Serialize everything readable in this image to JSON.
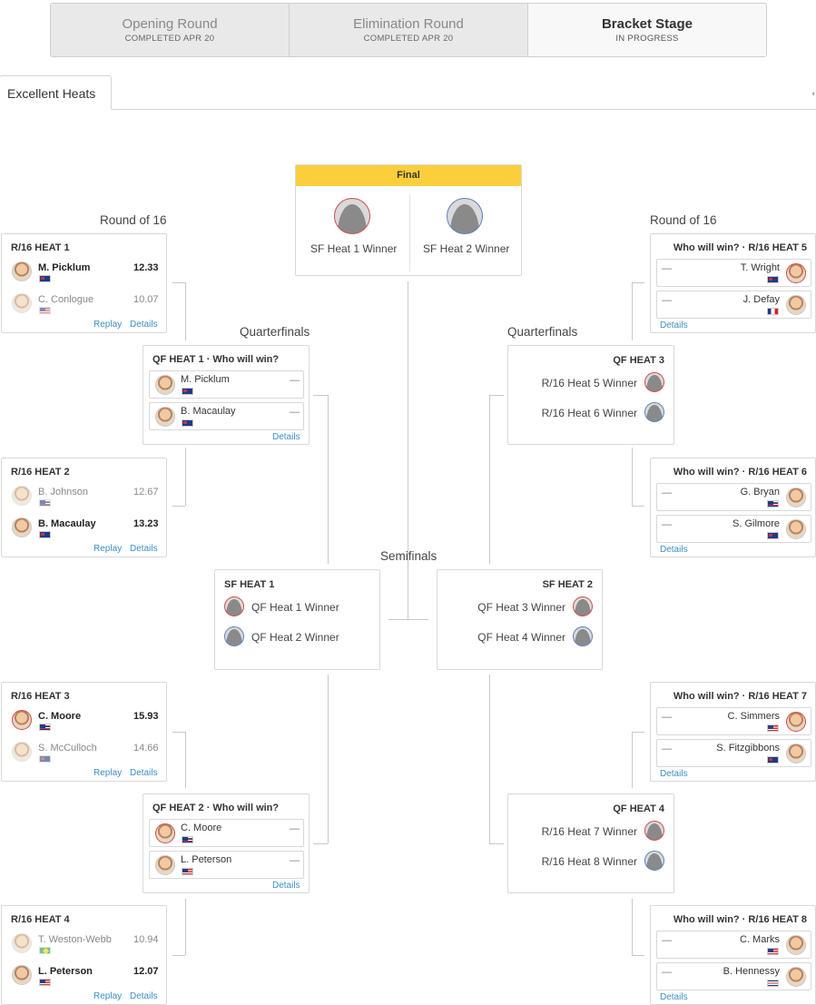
{
  "rounds": [
    {
      "name": "Opening Round",
      "status": "COMPLETED APR 20"
    },
    {
      "name": "Elimination Round",
      "status": "COMPLETED APR 20"
    },
    {
      "name": "Bracket Stage",
      "status": "IN PROGRESS"
    }
  ],
  "heat_tab": "Excellent Heats",
  "labels": {
    "round_of_16": "Round of 16",
    "quarterfinals": "Quarterfinals",
    "semifinals": "Semifinals",
    "final": "Final",
    "replay": "Replay",
    "details": "Details",
    "dash": "—"
  },
  "r16_left": [
    {
      "title": "R/16 HEAT 1",
      "surfers": [
        {
          "name": "M. Picklum",
          "country": "AUS",
          "score": "12.33",
          "winner": true
        },
        {
          "name": "C. Conlogue",
          "country": "USA",
          "score": "10.07",
          "winner": false
        }
      ]
    },
    {
      "title": "R/16 HEAT 2",
      "surfers": [
        {
          "name": "B. Johnson",
          "country": "HAW",
          "score": "12.67",
          "winner": false
        },
        {
          "name": "B. Macaulay",
          "country": "AUS",
          "score": "13.23",
          "winner": true
        }
      ]
    },
    {
      "title": "R/16 HEAT 3",
      "surfers": [
        {
          "name": "C. Moore",
          "country": "HAW",
          "score": "15.93",
          "winner": true
        },
        {
          "name": "S. McCulloch",
          "country": "AUS",
          "score": "14.66",
          "winner": false
        }
      ]
    },
    {
      "title": "R/16 HEAT 4",
      "surfers": [
        {
          "name": "T. Weston-Webb",
          "country": "BRA",
          "score": "10.94",
          "winner": false
        },
        {
          "name": "L. Peterson",
          "country": "USA",
          "score": "12.07",
          "winner": true
        }
      ]
    }
  ],
  "r16_right": [
    {
      "title": "Who will win? · R/16 HEAT 5",
      "surfers": [
        {
          "name": "T. Wright",
          "country": "AUS"
        },
        {
          "name": "J. Defay",
          "country": "FRA"
        }
      ]
    },
    {
      "title": "Who will win? · R/16 HEAT 6",
      "surfers": [
        {
          "name": "G. Bryan",
          "country": "HAW"
        },
        {
          "name": "S. Gilmore",
          "country": "AUS"
        }
      ]
    },
    {
      "title": "Who will win? · R/16 HEAT 7",
      "surfers": [
        {
          "name": "C. Simmers",
          "country": "USA"
        },
        {
          "name": "S. Fitzgibbons",
          "country": "AUS"
        }
      ]
    },
    {
      "title": "Who will win? · R/16 HEAT 8",
      "surfers": [
        {
          "name": "C. Marks",
          "country": "USA"
        },
        {
          "name": "B. Hennessy",
          "country": "CRI"
        }
      ]
    }
  ],
  "qf_left": [
    {
      "title": "QF HEAT 1 · Who will win?",
      "surfers": [
        {
          "name": "M. Picklum",
          "country": "AUS"
        },
        {
          "name": "B. Macaulay",
          "country": "AUS"
        }
      ]
    },
    {
      "title": "QF HEAT 2 · Who will win?",
      "surfers": [
        {
          "name": "C. Moore",
          "country": "HAW"
        },
        {
          "name": "L. Peterson",
          "country": "USA"
        }
      ]
    }
  ],
  "qf_right": [
    {
      "title": "QF HEAT 3",
      "slots": [
        "R/16 Heat 5 Winner",
        "R/16 Heat 6 Winner"
      ]
    },
    {
      "title": "QF HEAT 4",
      "slots": [
        "R/16 Heat 7 Winner",
        "R/16 Heat 8 Winner"
      ]
    }
  ],
  "sf": [
    {
      "title": "SF HEAT 1",
      "slots": [
        "QF Heat 1 Winner",
        "QF Heat 2 Winner"
      ]
    },
    {
      "title": "SF HEAT 2",
      "slots": [
        "QF Heat 3 Winner",
        "QF Heat 4 Winner"
      ]
    }
  ],
  "final": {
    "slots": [
      "SF Heat 1 Winner",
      "SF Heat 2 Winner"
    ]
  },
  "colors": {
    "final_header": "#fbcf3b",
    "link": "#3a8fc7",
    "red_jersey": "#d24a4a",
    "blue_jersey": "#5a7fc4"
  }
}
